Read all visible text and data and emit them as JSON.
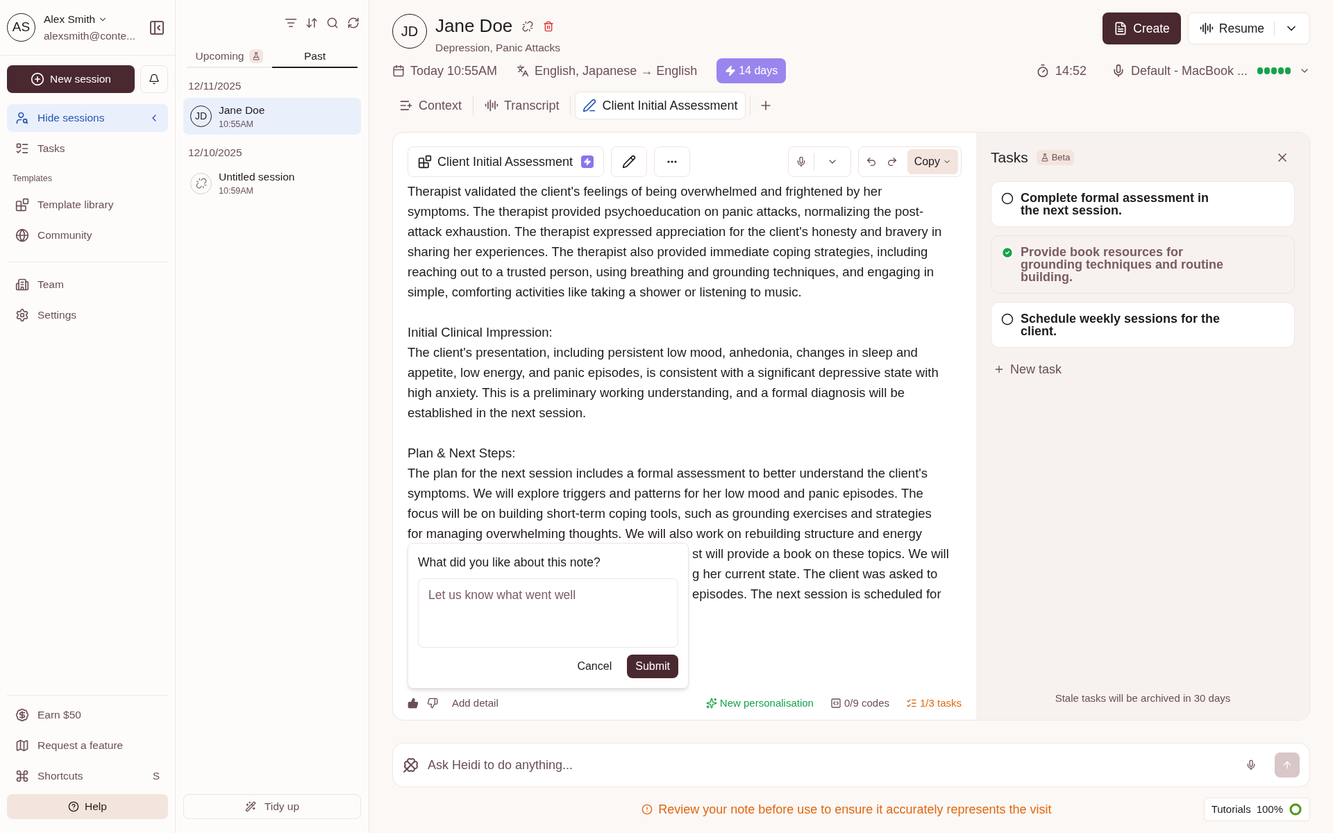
{
  "account": {
    "initials": "AS",
    "name": "Alex Smith",
    "email": "alexsmith@conte..."
  },
  "sidebar": {
    "new_session": "New session",
    "nav": [
      {
        "label": "Hide sessions",
        "selected": true
      },
      {
        "label": "Tasks",
        "selected": false
      }
    ],
    "templates_heading": "Templates",
    "templates": [
      {
        "label": "Template library"
      },
      {
        "label": "Community"
      }
    ],
    "workspace": [
      {
        "label": "Team"
      },
      {
        "label": "Settings"
      }
    ],
    "bottom": [
      {
        "label": "Earn $50"
      },
      {
        "label": "Request a feature"
      },
      {
        "label": "Shortcuts",
        "shortcut": "S"
      }
    ],
    "help": "Help"
  },
  "sessions": {
    "tabs": [
      {
        "label": "Upcoming",
        "selected": false
      },
      {
        "label": "Past",
        "selected": true
      }
    ],
    "groups": [
      {
        "date": "12/11/2025",
        "items": [
          {
            "kind": "patient",
            "initials": "JD",
            "title": "Jane Doe",
            "time": "10:55AM",
            "selected": true
          }
        ]
      },
      {
        "date": "12/10/2025",
        "items": [
          {
            "kind": "untitled",
            "title": "Untitled session",
            "time": "10:59AM",
            "selected": false
          }
        ]
      }
    ],
    "tidy": "Tidy up"
  },
  "header": {
    "initials": "JD",
    "name": "Jane Doe",
    "tags": "Depression, Panic Attacks",
    "date": "Today 10:55AM",
    "languages": "English, Japanese → English",
    "badge": "14 days",
    "timer": "14:52",
    "microphone": "Default - MacBook ...",
    "create": "Create",
    "resume": "Resume"
  },
  "tabs": [
    {
      "label": "Context",
      "selected": false
    },
    {
      "label": "Transcript",
      "selected": false
    },
    {
      "label": "Client Initial Assessment",
      "selected": true
    }
  ],
  "note": {
    "template": "Client Initial Assessment",
    "copy": "Copy",
    "paragraphs": [
      [
        "Therapist validated the client's feelings of being overwhelmed and frightened by her",
        "symptoms. The therapist provided psychoeducation on panic attacks, normalizing the post-",
        "attack exhaustion. The therapist expressed appreciation for the client's honesty and bravery in",
        "sharing her experiences. The therapist also provided immediate coping strategies, including",
        "reaching out to a trusted person, using breathing and grounding techniques, and engaging in",
        "simple, comforting activities like taking a shower or listening to music."
      ],
      [
        "Initial Clinical Impression:",
        "The client's presentation, including persistent low mood, anhedonia, changes in sleep and",
        "appetite, low energy, and panic episodes, is consistent with a significant depressive state with",
        "high anxiety. This is a preliminary working understanding, and a formal diagnosis will be",
        "established in the next session."
      ],
      [
        "Plan & Next Steps:",
        "The plan for the next session includes a formal assessment to better understand the client's",
        "symptoms. We will explore triggers and patterns for her low mood and panic episodes. The",
        "focus will be on building short-term coping tools, such as grounding exercises and strategies",
        "for managing overwhelming thoughts. We will also work on rebuilding structure and energy"
      ]
    ],
    "covered_lines": [
      "st will provide a book on these topics. We will",
      "g her current state. The client was asked to",
      "episodes. The next session is scheduled for"
    ],
    "add_detail": "Add detail",
    "personalisation": "New personalisation",
    "codes": "0/9 codes",
    "tasks": "1/3 tasks"
  },
  "feedback": {
    "title": "What did you like about this note?",
    "placeholder": "Let us know what went well",
    "cancel": "Cancel",
    "submit": "Submit"
  },
  "tasks": {
    "title": "Tasks",
    "badge": "Beta",
    "items": [
      {
        "text": "Complete formal assessment in the next session.",
        "checked": false
      },
      {
        "text": "Provide book resources for grounding techniques and routine building.",
        "checked": true
      },
      {
        "text": "Schedule weekly sessions for the client.",
        "checked": false
      }
    ],
    "new_task": "New task",
    "footer": "Stale tasks will be archived in 30 days"
  },
  "ask": {
    "placeholder": "Ask Heidi to do anything..."
  },
  "warning": "Review your note before use to ensure it accurately represents the visit",
  "tutorials": {
    "label": "Tutorials",
    "percent": "100%",
    "level": 1
  }
}
